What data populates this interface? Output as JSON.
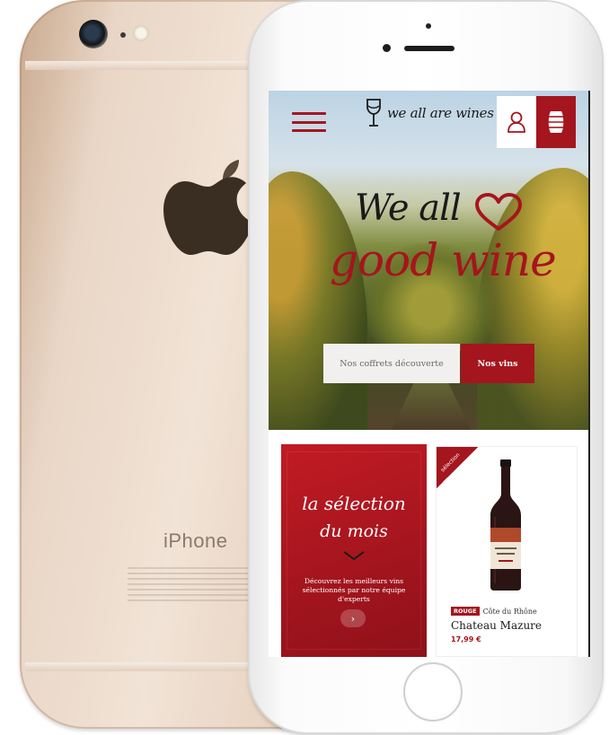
{
  "device": {
    "back_label": "iPhone"
  },
  "header": {
    "logo_text": "we all are wines",
    "menu_icon": "hamburger-menu-icon",
    "account_icon": "user-icon",
    "cart_icon": "wine-barrel-icon"
  },
  "hero": {
    "line1": "We all",
    "line2": "good wine",
    "heart_icon": "heart-icon",
    "btn_discover": "Nos coffrets découverte",
    "btn_wines": "Nos vins"
  },
  "promo": {
    "title_line1": "la sélection",
    "title_line2": "du mois",
    "description": "Découvrez les meilleurs vins sélectionnés par notre équipe d'experts",
    "arrow": "›"
  },
  "product": {
    "ribbon": "sélection",
    "badge": "ROUGE",
    "region": "Côte du Rhône",
    "name": "Chateau Mazure",
    "price": "17,99 €"
  },
  "colors": {
    "brand_red": "#a5151e",
    "back_phone_gold": "#e9d6c6",
    "front_phone_white": "#ffffff"
  }
}
